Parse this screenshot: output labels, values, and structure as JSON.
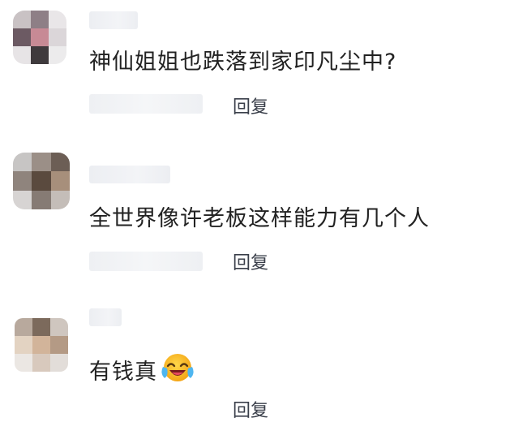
{
  "comments": [
    {
      "text": "神仙姐姐也跌落到家印凡尘中?",
      "reply_label": "回复",
      "avatar_icon": "pixelated-avatar"
    },
    {
      "text": "全世界像许老板这样能力有几个人",
      "reply_label": "回复",
      "avatar_icon": "pixelated-avatar"
    },
    {
      "text": "有钱真",
      "emoji": "laughing-crying-emoji",
      "reply_label": "回复",
      "avatar_icon": "pixelated-avatar"
    }
  ],
  "colors": {
    "text": "#222222",
    "reply": "#3a3f4a",
    "background": "#ffffff"
  }
}
